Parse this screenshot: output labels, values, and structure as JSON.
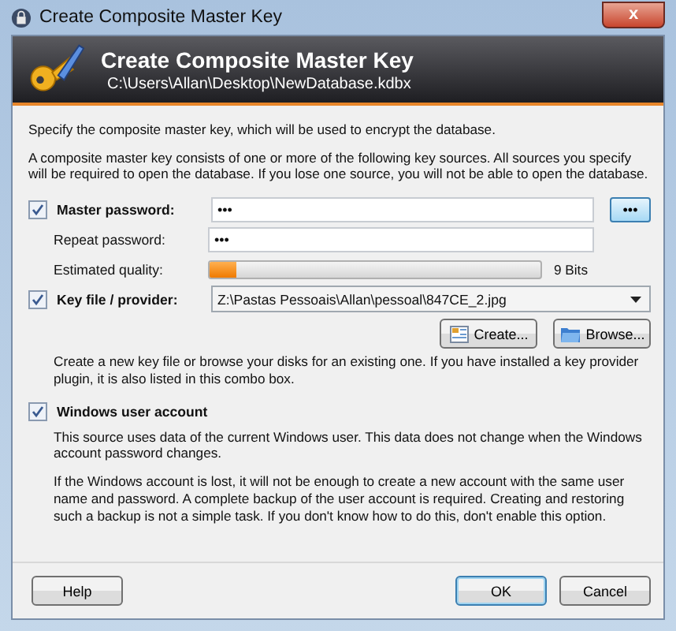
{
  "window": {
    "title": "Create Composite Master Key",
    "close": "x"
  },
  "banner": {
    "title": "Create Composite Master Key",
    "subtitle": "C:\\Users\\Allan\\Desktop\\NewDatabase.kdbx"
  },
  "intro": [
    "Specify the composite master key, which will be used to encrypt the database.",
    "A composite master key consists of one or more of the following key sources. All sources you specify will be required to open the database.  If you lose one source, you will not be able to open the database."
  ],
  "master_password": {
    "label": "Master password:",
    "checked": true,
    "value": "•••",
    "reveal_button": "•••",
    "repeat_label": "Repeat password:",
    "repeat_value": "•••",
    "quality_label": "Estimated quality:",
    "level": 0.08,
    "quality_reading": "9 Bits"
  },
  "key_file": {
    "label": "Key file / provider:",
    "checked": true,
    "value": "Z:\\Pastas Pessoais\\Allan\\pessoal\\847CE_2.jpg",
    "buttons": [
      "Create...",
      "Browse..."
    ],
    "hint": "Create a new key file or browse your disks for an existing one. If you have installed a key provider plugin, it is also listed in this combo box."
  },
  "windows_account": {
    "label": "Windows user account",
    "checked": true,
    "notes": [
      "This source uses data of the current Windows user. This data does not change when the Windows account password changes.",
      "If the Windows account is lost, it will not be enough to create a new account with the same user name and password. A complete backup of the user account is required. Creating and restoring such a backup is not a simple task. If you don't know how to do this, don't enable this option."
    ]
  },
  "buttons": {
    "help": "Help",
    "ok": "OK",
    "cancel": "Cancel"
  }
}
